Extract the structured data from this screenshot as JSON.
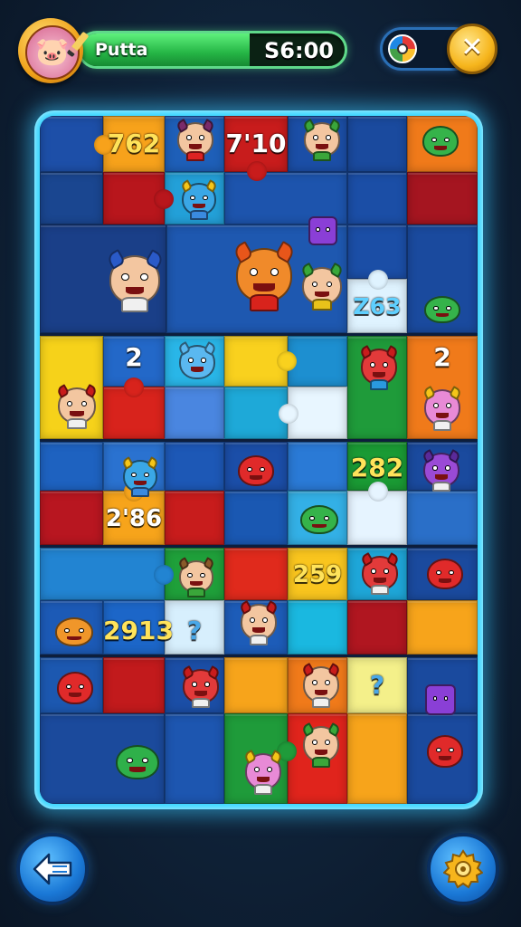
{
  "hud": {
    "player_name": "Putta",
    "timer": "S6:00",
    "avatar_emoji": "🐷"
  },
  "board": {
    "numbers": {
      "n1": "762",
      "n2": "7'10",
      "n3": "Z63",
      "n4": "2",
      "n5": "2",
      "n6": "282",
      "n7": "2'86",
      "n8": "259",
      "n9": "2913",
      "q1": "?",
      "q2": "?"
    }
  },
  "colors": {
    "accent_frame": "#3ad7ff",
    "bar_fill": "#2fc74f",
    "button_blue": "#1a78d6",
    "button_gold": "#f6b51c"
  },
  "icons": {
    "back": "back-arrow-icon",
    "settings": "gear-icon",
    "close": "close-icon",
    "powerup": "color-wheel-icon"
  },
  "close_label": "✕",
  "name_bar_fill_fraction": 0.64
}
